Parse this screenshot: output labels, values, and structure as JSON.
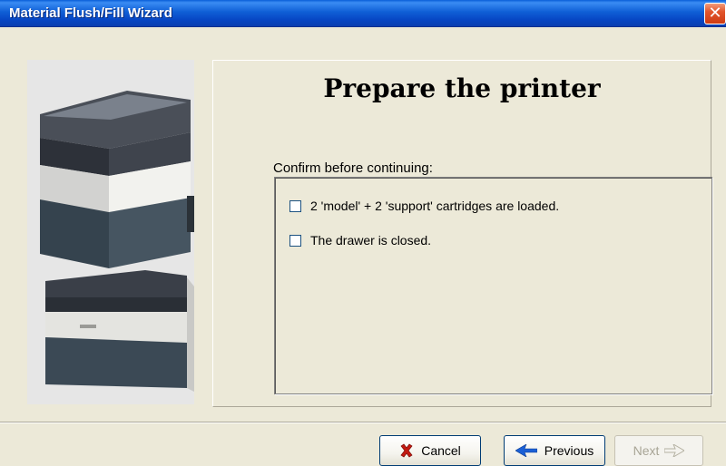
{
  "window": {
    "title": "Material Flush/Fill Wizard",
    "close_glyph": "✕"
  },
  "content": {
    "heading": "Prepare the printer",
    "subheading": "Confirm before continuing:",
    "checklist": [
      {
        "label": "2 'model' + 2 'support' cartridges are loaded.",
        "checked": false
      },
      {
        "label": "The drawer is closed.",
        "checked": false
      }
    ]
  },
  "buttons": {
    "cancel": {
      "label": "Cancel",
      "icon": "x-icon"
    },
    "previous": {
      "label": "Previous",
      "icon": "left-arrow-icon"
    },
    "next": {
      "label": "Next",
      "icon": "right-arrow-icon",
      "enabled": false
    }
  },
  "colors": {
    "titlebar": "#0a5fd8",
    "window_bg": "#ece9d8",
    "close_button": "#e2562c",
    "cancel_icon": "#c41a12",
    "previous_icon": "#1a5fd6"
  }
}
